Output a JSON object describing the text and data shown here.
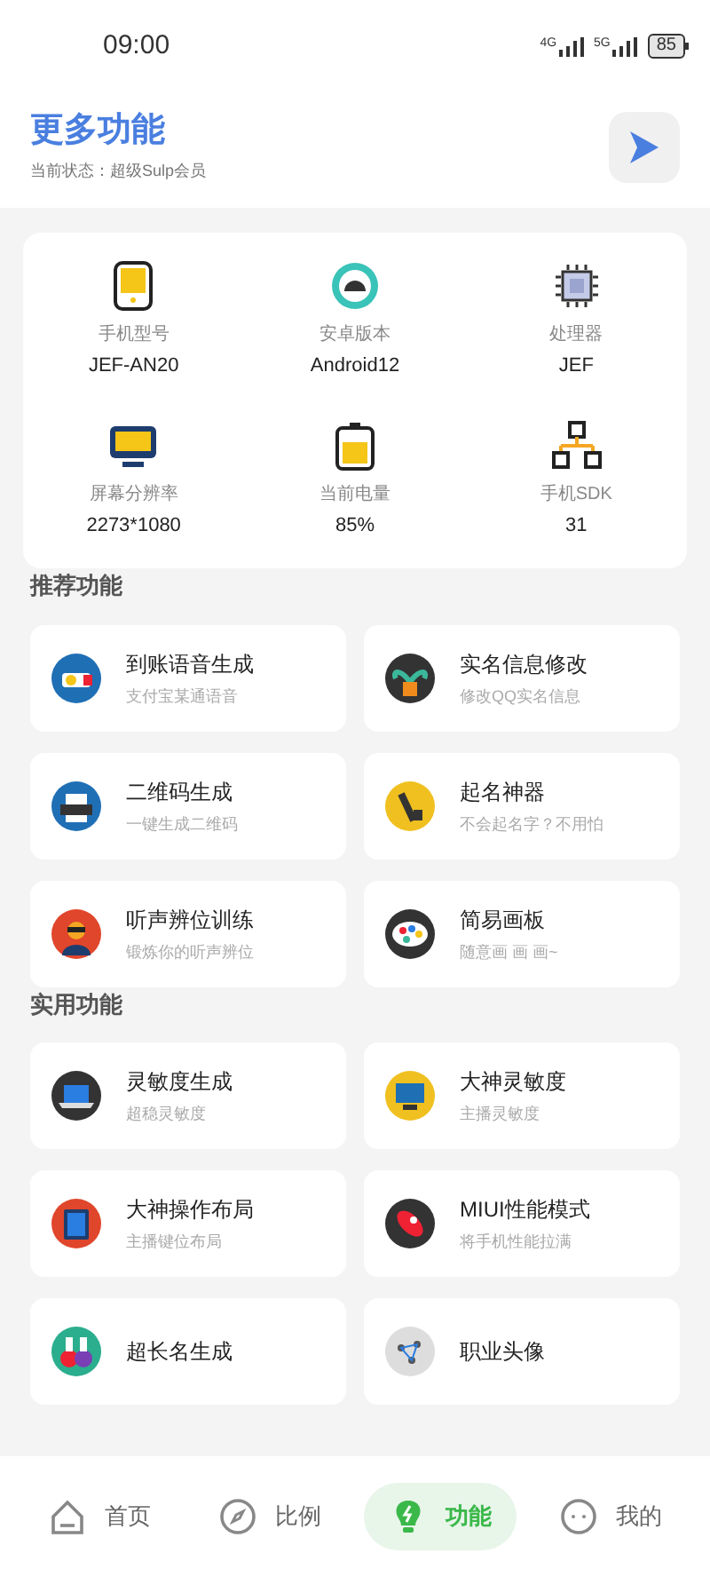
{
  "status_bar": {
    "time": "09:00",
    "network_1": "4G",
    "network_2": "5G",
    "battery": "85"
  },
  "header": {
    "title": "更多功能",
    "subtitle": "当前状态：超级Sulp会员"
  },
  "device_info": [
    {
      "label": "手机型号",
      "value": "JEF-AN20"
    },
    {
      "label": "安卓版本",
      "value": "Android12"
    },
    {
      "label": "处理器",
      "value": "JEF"
    },
    {
      "label": "屏幕分辨率",
      "value": "2273*1080"
    },
    {
      "label": "当前电量",
      "value": "85%"
    },
    {
      "label": "手机SDK",
      "value": "31"
    }
  ],
  "sections": [
    {
      "title": "推荐功能",
      "items": [
        {
          "title": "到账语音生成",
          "subtitle": "支付宝某通语音"
        },
        {
          "title": "实名信息修改",
          "subtitle": "修改QQ实名信息"
        },
        {
          "title": "二维码生成",
          "subtitle": "一键生成二维码"
        },
        {
          "title": "起名神器",
          "subtitle": "不会起名字？不用怕"
        },
        {
          "title": "听声辨位训练",
          "subtitle": "锻炼你的听声辨位"
        },
        {
          "title": "简易画板",
          "subtitle": "随意画 画 画~"
        }
      ]
    },
    {
      "title": "实用功能",
      "items": [
        {
          "title": "灵敏度生成",
          "subtitle": "超稳灵敏度"
        },
        {
          "title": "大神灵敏度",
          "subtitle": "主播灵敏度"
        },
        {
          "title": "大神操作布局",
          "subtitle": "主播键位布局"
        },
        {
          "title": "MIUI性能模式",
          "subtitle": "将手机性能拉满"
        },
        {
          "title": "超长名生成"
        },
        {
          "title": "职业头像"
        }
      ]
    }
  ],
  "nav": [
    {
      "label": "首页",
      "selected": false
    },
    {
      "label": "比例",
      "selected": false
    },
    {
      "label": "功能",
      "selected": true
    },
    {
      "label": "我的",
      "selected": false
    }
  ]
}
